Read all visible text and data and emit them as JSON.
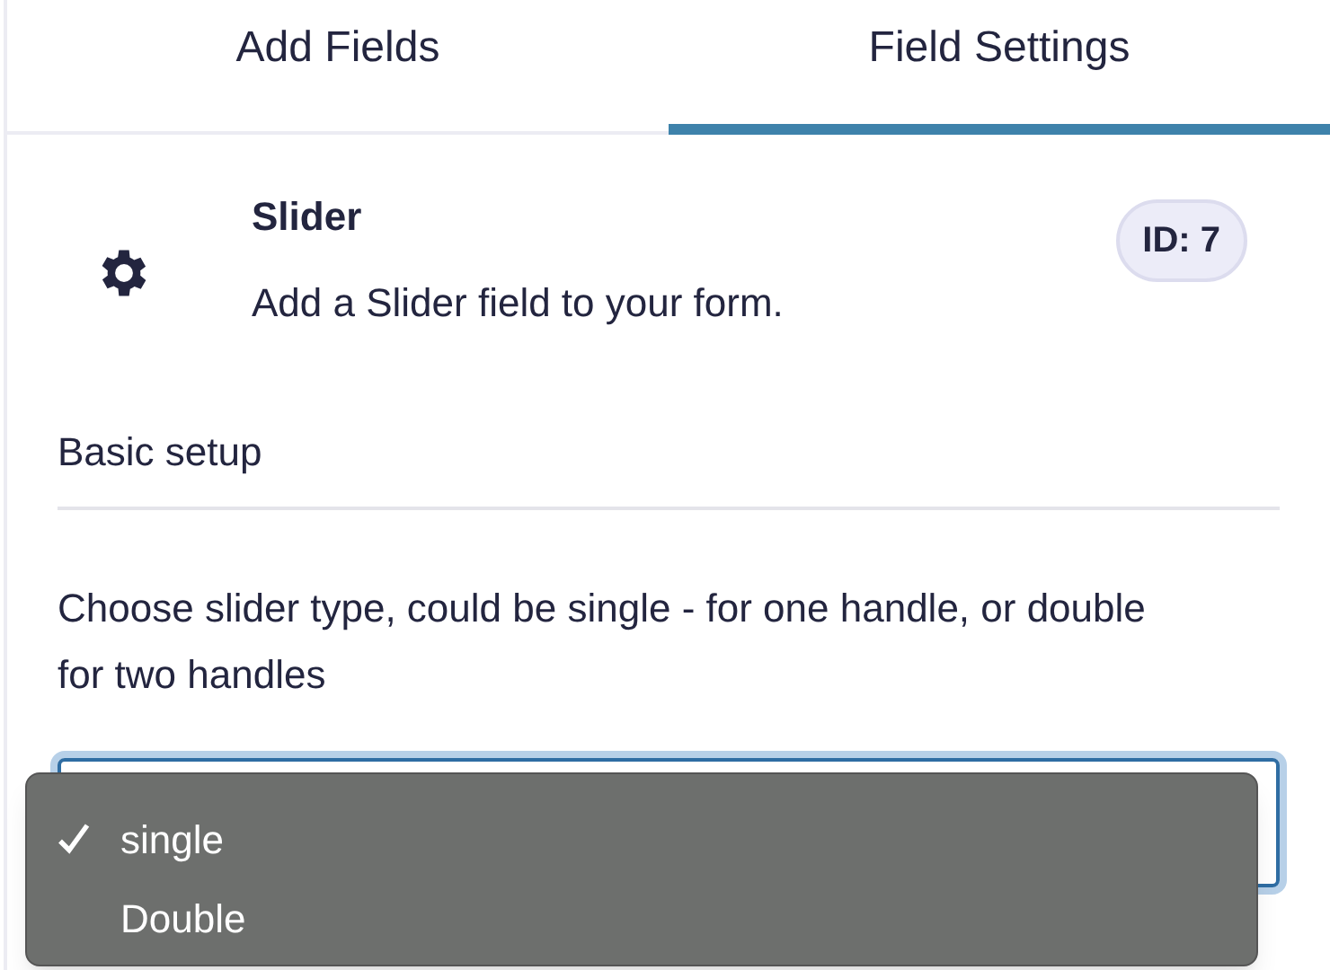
{
  "tabs": [
    {
      "label": "Add Fields",
      "selected": false
    },
    {
      "label": "Field Settings",
      "selected": true
    }
  ],
  "field": {
    "title": "Slider",
    "description": "Add a Slider field to your form.",
    "badge": "ID: 7"
  },
  "section": {
    "title": "Basic setup"
  },
  "setting": {
    "description": "Choose slider type, could be single - for one handle, or double for two handles",
    "select": {
      "focused": true,
      "options": [
        {
          "label": "single",
          "selected": true
        },
        {
          "label": "Double",
          "selected": false
        }
      ]
    }
  }
}
